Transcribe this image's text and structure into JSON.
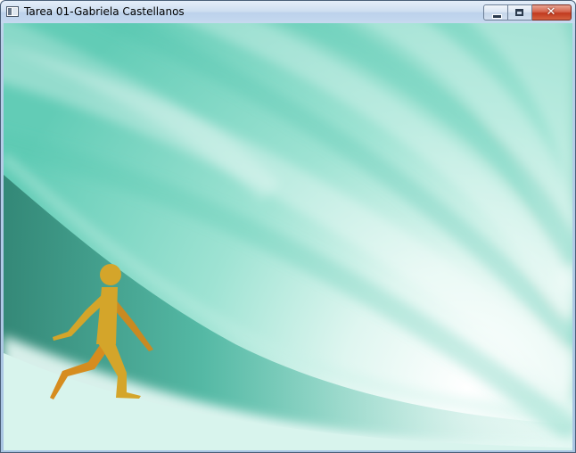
{
  "window": {
    "title": "Tarea 01-Gabriela Castellanos",
    "icon": "app-window-icon"
  },
  "caption_buttons": {
    "minimize_icon": "minimize-icon",
    "maximize_icon": "maximize-icon",
    "close_icon": "close-icon",
    "close_glyph": "✕"
  },
  "canvas": {
    "background": "teal-swirl",
    "colors": {
      "light": "#f4fdfb",
      "mid": "#9ee3d3",
      "base": "#5fcbb5",
      "dark": "#2b7c6c"
    },
    "figure": {
      "icon": "walking-person-icon",
      "color_body": "#d4a52a",
      "color_limb_back": "#d68c1f"
    }
  }
}
